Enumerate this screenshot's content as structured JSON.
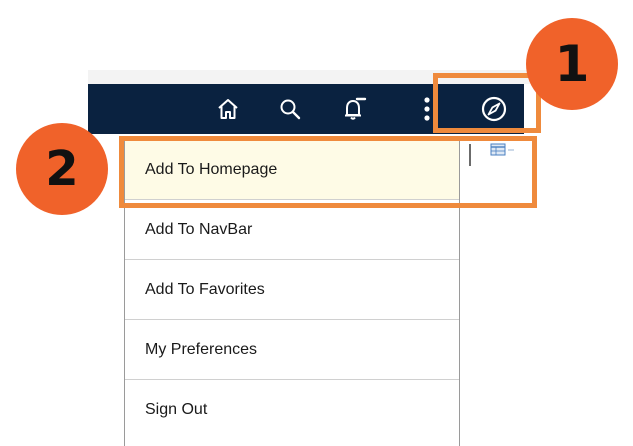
{
  "navbar": {
    "icons": [
      "home-icon",
      "search-icon",
      "bell-icon",
      "more-vertical-icon",
      "compass-icon"
    ],
    "background": "#0a2240"
  },
  "menu": {
    "items": [
      {
        "label": "Add To Homepage",
        "highlighted": true
      },
      {
        "label": "Add To NavBar"
      },
      {
        "label": "Add To Favorites"
      },
      {
        "label": "My Preferences"
      },
      {
        "label": "Sign Out"
      }
    ]
  },
  "callouts": {
    "one": "1",
    "two": "2",
    "accent": "#ef8a3c",
    "badge_color": "#f0622a"
  }
}
